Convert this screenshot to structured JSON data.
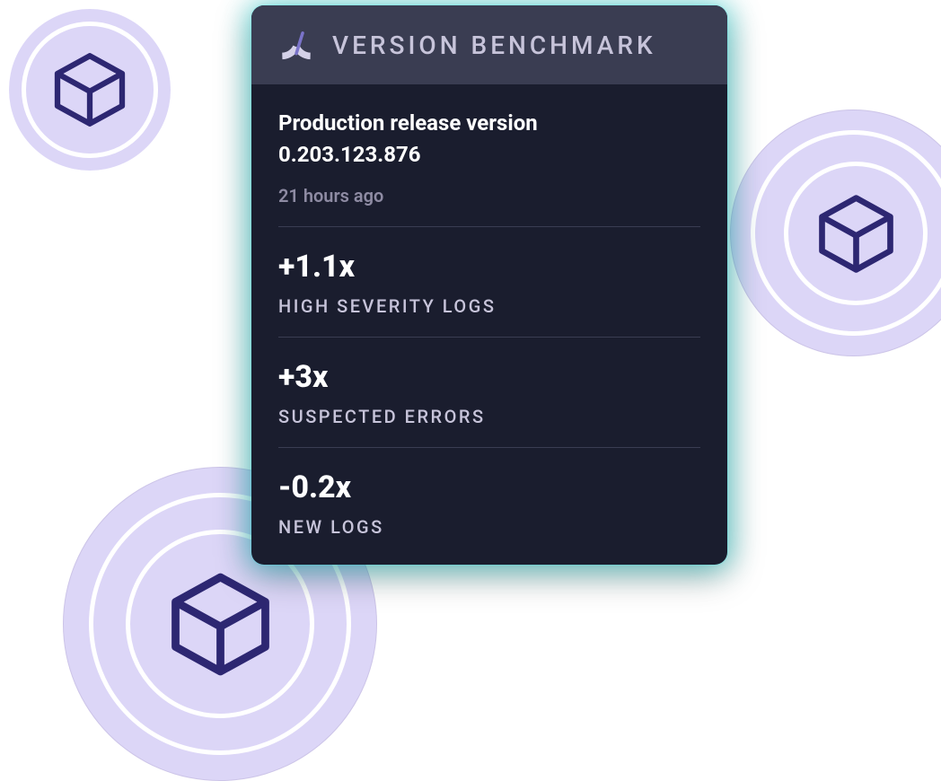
{
  "card": {
    "title": "VERSION BENCHMARK",
    "release_label": "Production release version",
    "release_version": "0.203.123.876",
    "release_time": "21 hours ago",
    "metrics": [
      {
        "value": "+1.1x",
        "label": "HIGH SEVERITY LOGS"
      },
      {
        "value": "+3x",
        "label": "SUSPECTED ERRORS"
      },
      {
        "value": "-0.2x",
        "label": "NEW LOGS"
      }
    ]
  },
  "colors": {
    "card_bg": "#1a1d2e",
    "header_bg": "#3a3d52",
    "text_primary": "#ffffff",
    "text_muted": "#8e8ba3",
    "text_header": "#c7c4da",
    "badge_bg": "#dcd6f7",
    "cube_stroke": "#2d2772",
    "glow": "#00e6e6"
  },
  "icons": {
    "gauge": "gauge-icon",
    "cube": "cube-icon"
  }
}
